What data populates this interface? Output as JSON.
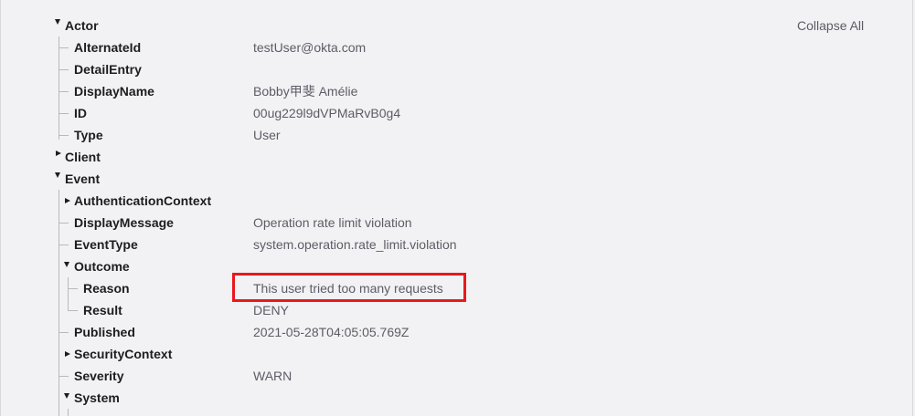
{
  "toolbar": {
    "collapse_all": "Collapse All"
  },
  "tree": {
    "actor": {
      "label": "Actor",
      "alternate_id": {
        "key": "AlternateId",
        "value": "testUser@okta.com"
      },
      "detail_entry": {
        "key": "DetailEntry"
      },
      "display_name": {
        "key": "DisplayName",
        "value": "Bobby甲斐 Amélie"
      },
      "id": {
        "key": "ID",
        "value": "00ug229l9dVPMaRvB0g4"
      },
      "type": {
        "key": "Type",
        "value": "User"
      }
    },
    "client": {
      "label": "Client"
    },
    "event": {
      "label": "Event",
      "authentication_context": {
        "key": "AuthenticationContext"
      },
      "display_message": {
        "key": "DisplayMessage",
        "value": "Operation rate limit violation"
      },
      "event_type": {
        "key": "EventType",
        "value": "system.operation.rate_limit.violation"
      },
      "outcome": {
        "key": "Outcome",
        "reason": {
          "key": "Reason",
          "value": "This user tried too many requests"
        },
        "result": {
          "key": "Result",
          "value": "DENY"
        }
      },
      "published": {
        "key": "Published",
        "value": "2021-05-28T04:05:05.769Z"
      },
      "security_context": {
        "key": "SecurityContext"
      },
      "severity": {
        "key": "Severity",
        "value": "WARN"
      },
      "system": {
        "key": "System"
      }
    }
  },
  "colors": {
    "highlight_border": "#e8191c",
    "background": "#f2f2f4"
  }
}
